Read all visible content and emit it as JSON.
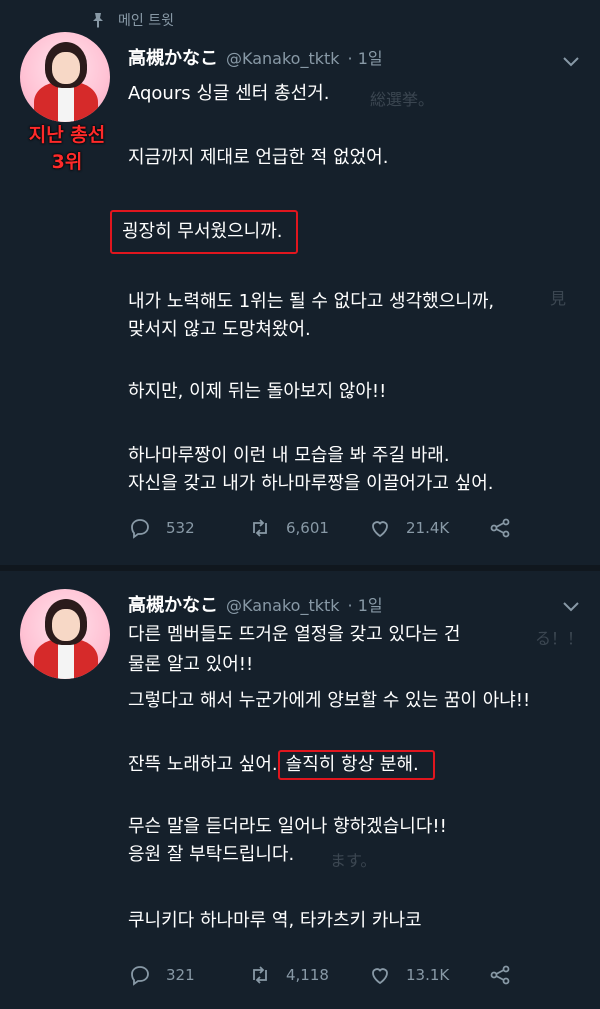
{
  "pinned_label": "메인 트윗",
  "tweets": [
    {
      "author": "高槻かなこ",
      "handle": "@Kanako_tktk",
      "time": "· 1일",
      "image_overlay": [
        "지난 총선",
        "3위"
      ],
      "lines": [
        "Aqours 싱글 센터 총선거.",
        "지금까지 제대로 언급한 적 없었어.",
        "굉장히 무서웠으니까.",
        "내가 노력해도 1위는 될 수 없다고 생각했으니까,",
        "맞서지 않고 도망쳐왔어.",
        "하지만, 이제 뒤는 돌아보지 않아!!",
        "하나마루짱이 이런 내 모습을 봐 주길 바래.",
        "자신을 갖고 내가 하나마루짱을 이끌어가고 싶어."
      ],
      "reply_count": "532",
      "retweet_count": "6,601",
      "like_count": "21.4K"
    },
    {
      "author": "高槻かなこ",
      "handle": "@Kanako_tktk",
      "time": "· 1일",
      "lines": [
        "다른 멤버들도 뜨거운 열정을 갖고 있다는 건",
        "물론 알고 있어!!",
        "그렇다고 해서 누군가에게 양보할 수 있는 꿈이 아냐!!",
        "잔뜩 노래하고 싶어.",
        "솔직히 항상 분해.",
        "무슨 말을 듣더라도 일어나 향하겠습니다!!",
        "응원 잘 부탁드립니다.",
        "쿠니키다 하나마루 역, 타카츠키 카나코"
      ],
      "reply_count": "321",
      "retweet_count": "4,118",
      "like_count": "13.1K"
    }
  ],
  "icons": {
    "pin": "pin-icon",
    "chevron": "chevron-down-icon",
    "reply": "reply-icon",
    "retweet": "retweet-icon",
    "like": "like-icon",
    "share": "share-icon"
  },
  "colors": {
    "background": "#15202b",
    "divider": "#10171e",
    "text": "#ffffff",
    "secondary": "#8899a6",
    "highlight_box": "#e0161e",
    "overlay_text": "#ff2a2a"
  }
}
